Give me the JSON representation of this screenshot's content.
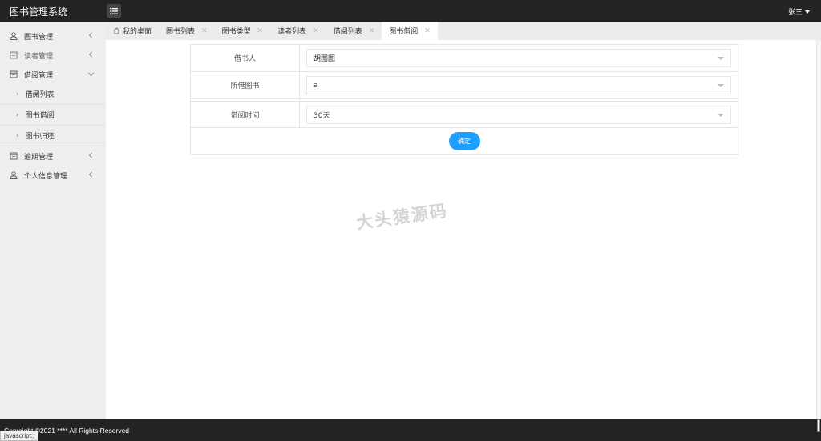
{
  "header": {
    "app_title": "图书管理系统",
    "username": "张三"
  },
  "sidebar": {
    "items": [
      {
        "label": "图书管理",
        "icon": "user-icon"
      },
      {
        "label": "读者管理",
        "icon": "doc-icon"
      },
      {
        "label": "借阅管理",
        "icon": "doc-icon",
        "expanded": true,
        "children": [
          {
            "label": "借阅列表"
          },
          {
            "label": "图书借阅"
          },
          {
            "label": "图书归还"
          }
        ]
      },
      {
        "label": "逾期管理",
        "icon": "doc-icon"
      },
      {
        "label": "个人信息管理",
        "icon": "user-icon"
      }
    ]
  },
  "tabs": [
    {
      "label": "我的桌面",
      "home": true
    },
    {
      "label": "图书列表"
    },
    {
      "label": "图书类型"
    },
    {
      "label": "读者列表"
    },
    {
      "label": "借阅列表"
    },
    {
      "label": "图书借阅",
      "active": true
    }
  ],
  "form": {
    "borrower_label": "借书人",
    "borrower_value": "胡图图",
    "book_label": "所借图书",
    "book_value": "a",
    "duration_label": "借阅时间",
    "duration_value": "30天",
    "submit_label": "确定"
  },
  "watermark": "大头猿源码",
  "footer": {
    "copyright": "Copyright ©2021 **** All Rights Reserved",
    "status_tip": "javascript:;"
  },
  "colors": {
    "header_bg": "#232323",
    "sidebar_bg": "#eeeeee",
    "primary_button": "#1e9fff"
  }
}
